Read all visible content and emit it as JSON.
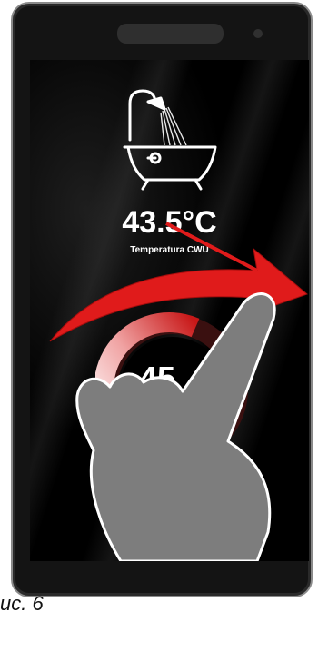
{
  "screen": {
    "temperature_value": "43.5°C",
    "temperature_label": "Temperatura CWU",
    "dial_value": "45",
    "icon": "bathtub-shower-icon"
  },
  "gesture": {
    "type": "swipe-right",
    "icon": "hand-pointer-icon",
    "arrow_color": "#e01b1b"
  },
  "caption": "ис. 6",
  "colors": {
    "screen_bg": "#000000",
    "text": "#ffffff",
    "arrow": "#e01b1b",
    "hand": "#7d7d7d"
  }
}
